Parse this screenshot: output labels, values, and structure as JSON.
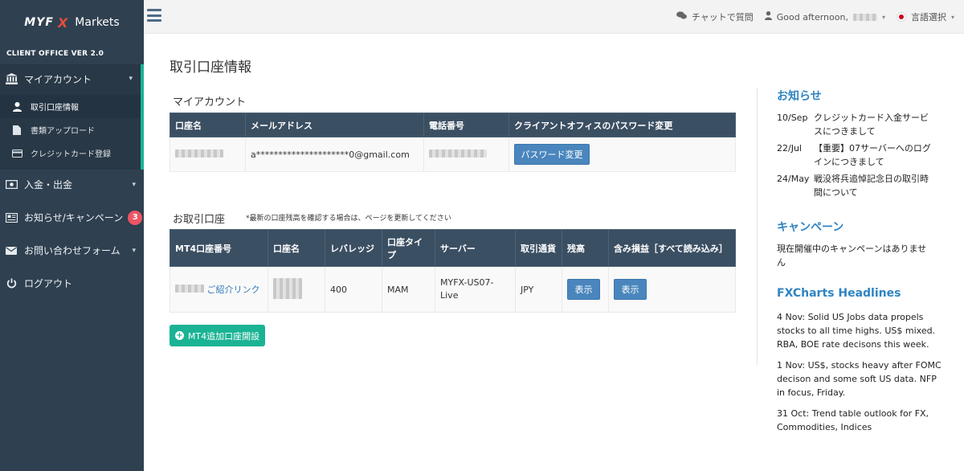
{
  "sidebar": {
    "logo_brand": "MYF",
    "logo_x": "X",
    "logo_markets": "Markets",
    "version": "CLIENT OFFICE VER 2.0",
    "my_account": "マイアカウント",
    "sub_items": [
      {
        "label": "取引口座情報"
      },
      {
        "label": "書類アップロード"
      },
      {
        "label": "クレジットカード登録"
      }
    ],
    "deposit": "入金・出金",
    "news": "お知らせ/キャンペーン",
    "news_badge": "3",
    "contact": "お問い合わせフォーム",
    "logout": "ログアウト",
    "accent_color": "#1ab394",
    "bg_color": "#2f4050"
  },
  "topbar": {
    "chat": "チャットで質問",
    "greeting": "Good afternoon,",
    "language": "言語選択"
  },
  "main": {
    "page_title": "取引口座情報",
    "my_account_title": "マイアカウント",
    "account_headers": [
      "口座名",
      "メールアドレス",
      "電話番号",
      "クライアントオフィスのパスワード変更"
    ],
    "email": "a*********************0@gmail.com",
    "password_button": "パスワード変更",
    "trading_title": "お取引口座",
    "trading_note": "*最新の口座残高を確認する場合は、ページを更新してください",
    "trading_headers": [
      "MT4口座番号",
      "口座名",
      "レバレッジ",
      "口座タイプ",
      "サーバー",
      "取引通貨",
      "残高",
      "含み損益［すべて読み込み］"
    ],
    "row": {
      "referral": "ご紹介リンク",
      "leverage": "400",
      "type": "MAM",
      "server": "MYFX-US07-Live",
      "currency": "JPY",
      "show_balance": "表示",
      "show_pl": "表示"
    },
    "add_account_button": "MT4追加口座開設"
  },
  "right": {
    "notice_title": "お知らせ",
    "notices": [
      {
        "date": "10/Sep",
        "text": "クレジットカード入金サービスにつきまして"
      },
      {
        "date": "22/Jul",
        "text": "【重要】07サーバーへのログインにつきまして"
      },
      {
        "date": "24/May",
        "text": "戦没将兵追悼記念日の取引時間について"
      }
    ],
    "campaign_title": "キャンペーン",
    "campaign_text": "現在開催中のキャンペーンはありません",
    "fx_title": "FXCharts Headlines",
    "headlines": [
      {
        "text": "4 Nov: Solid US Jobs data propels stocks to all time highs. US$ mixed. RBA, BOE rate decisons this week."
      },
      {
        "text": "1 Nov: US$, stocks heavy after FOMC decison and some soft US data. NFP in focus, Friday."
      },
      {
        "text": "31 Oct: Trend table outlook for FX, Commodities, Indices"
      }
    ]
  }
}
